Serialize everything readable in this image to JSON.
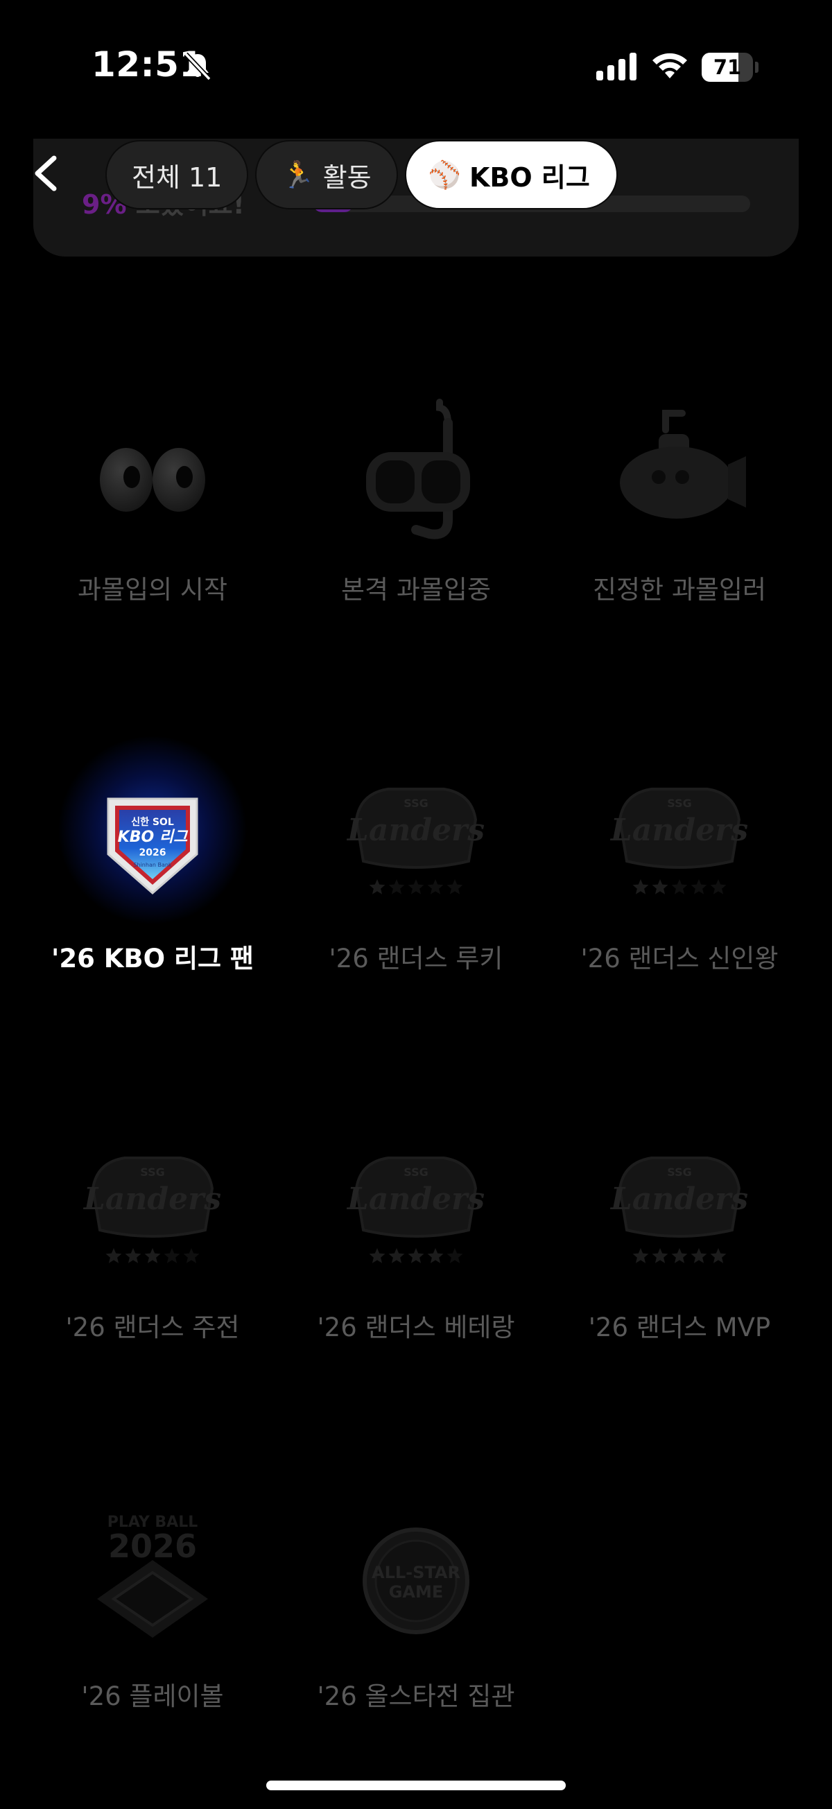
{
  "status_bar": {
    "time": "12:51",
    "battery_level": "71",
    "battery_fraction": 0.71,
    "icons": [
      "bell-slash-icon",
      "cellular-signal-icon",
      "wifi-icon",
      "battery-icon"
    ]
  },
  "progress": {
    "percent_text": "9%",
    "suffix_text": " 모았어요!",
    "fraction": 0.09,
    "accent_color": "#6a1f86"
  },
  "header": {
    "back_icon": "chevron-left-icon",
    "tabs": [
      {
        "label": "전체 11",
        "emoji": "",
        "active": false
      },
      {
        "label": "활동",
        "emoji": "🏃",
        "active": false
      },
      {
        "label": "KBO 리그",
        "emoji": "⚾",
        "active": true
      }
    ]
  },
  "badges": [
    {
      "label": "과몰입의 시작",
      "icon": "eyes-icon",
      "earned": false
    },
    {
      "label": "본격 과몰입중",
      "icon": "snorkel-mask-icon",
      "earned": false
    },
    {
      "label": "진정한 과몰입러",
      "icon": "submarine-icon",
      "earned": false
    },
    {
      "label": "'26 KBO 리그 팬",
      "icon": "kbo-league-badge-icon",
      "earned": true,
      "icon_text": {
        "line1": "신한 SOL",
        "line2": "KBO 리그",
        "line3": "2026",
        "line4": "Shinhan Bank"
      }
    },
    {
      "label": "'26 랜더스 루키",
      "icon": "landers-logo-icon",
      "earned": false,
      "stars": 1
    },
    {
      "label": "'26 랜더스 신인왕",
      "icon": "landers-logo-icon",
      "earned": false,
      "stars": 2
    },
    {
      "label": "'26 랜더스 주전",
      "icon": "landers-logo-icon",
      "earned": false,
      "stars": 3
    },
    {
      "label": "'26 랜더스 베테랑",
      "icon": "landers-logo-icon",
      "earned": false,
      "stars": 4
    },
    {
      "label": "'26 랜더스 MVP",
      "icon": "landers-logo-icon",
      "earned": false,
      "stars": 5
    },
    {
      "label": "'26 플레이볼",
      "icon": "play-ball-stadium-icon",
      "earned": false
    },
    {
      "label": "'26 올스타전 집관",
      "icon": "all-star-game-icon",
      "earned": false
    }
  ],
  "landers_logo_text": {
    "top": "SSG",
    "main": "Landers"
  },
  "playball_text": {
    "line1": "PLAY BALL",
    "line2": "2026"
  },
  "allstar_text": {
    "line1": "ALL-STAR",
    "line2": "GAME"
  }
}
